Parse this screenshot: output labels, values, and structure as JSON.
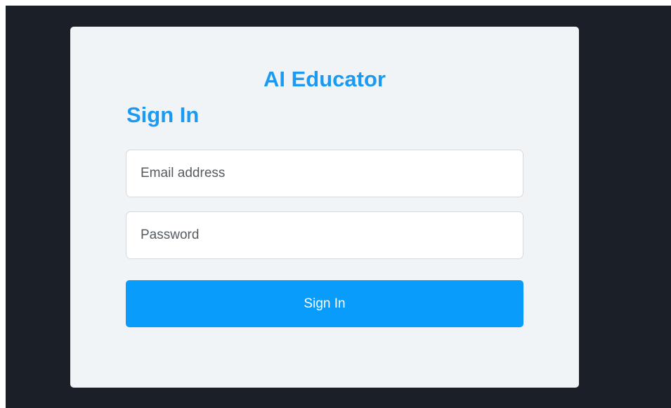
{
  "app": {
    "brand": "AI Educator"
  },
  "form": {
    "heading": "Sign In",
    "email": {
      "value": "",
      "placeholder": "Email address"
    },
    "password": {
      "value": "",
      "placeholder": "Password"
    },
    "submit_label": "Sign In"
  },
  "colors": {
    "accent": "#1a9af2",
    "button": "#099cfb",
    "card": "#f1f4f7",
    "backdrop": "#1b1f27"
  }
}
